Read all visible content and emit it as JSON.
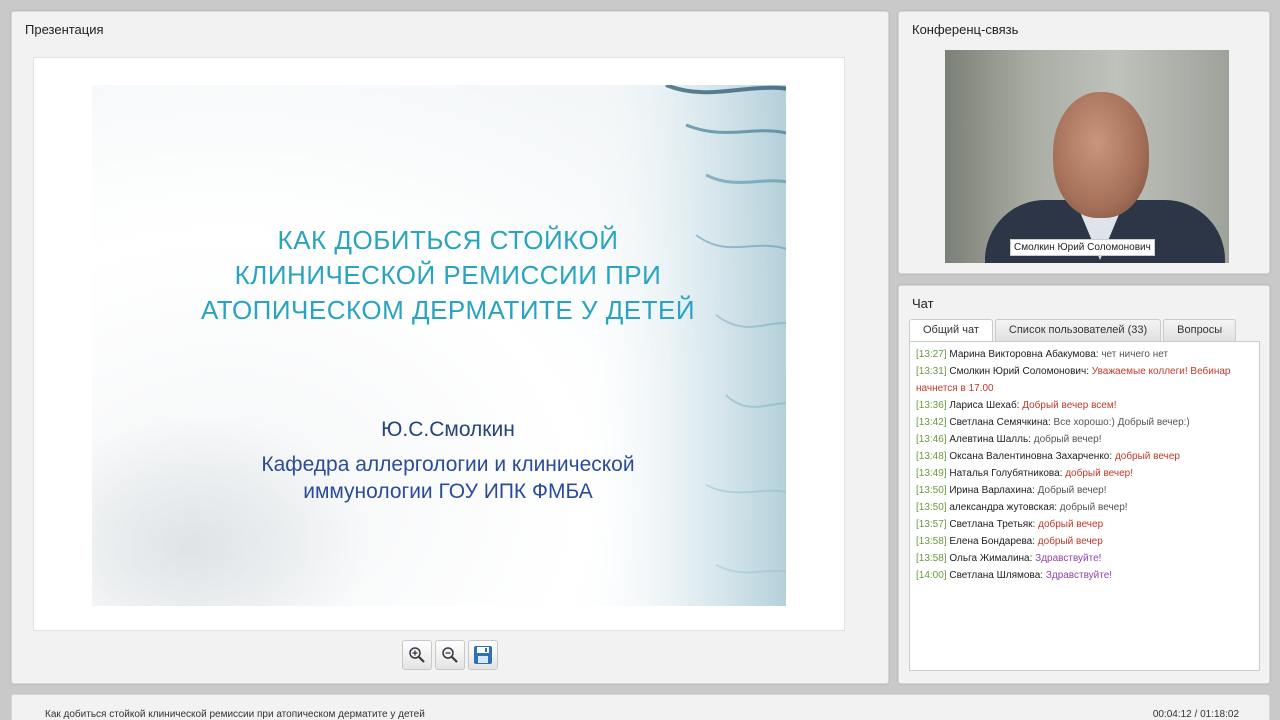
{
  "presentation": {
    "title": "Презентация",
    "slide": {
      "title_lines": [
        "КАК ДОБИТЬСЯ СТОЙКОЙ",
        "КЛИНИЧЕСКОЙ РЕМИССИИ ПРИ",
        "АТОПИЧЕСКОМ ДЕРМАТИТЕ У ДЕТЕЙ"
      ],
      "author": "Ю.С.Смолкин",
      "dept_lines": [
        "Кафедра аллергологии и клинической",
        "иммунологии ГОУ ИПК ФМБА"
      ]
    },
    "toolbar": {
      "zoom_in_icon": "zoom-in-icon",
      "zoom_out_icon": "zoom-out-icon",
      "save_icon": "floppy-disk-icon"
    }
  },
  "conference": {
    "title": "Конференц-связь",
    "speaker_name": "Смолкин Юрий Соломонович"
  },
  "chat": {
    "title": "Чат",
    "tabs": [
      "Общий чат",
      "Список пользователей (33)",
      "Вопросы"
    ],
    "active_tab": 0,
    "messages": [
      {
        "time": "[13:27]",
        "author": "Марина Викторовна Абакумова:",
        "text": "чет ничего нет",
        "color": "#555555"
      },
      {
        "time": "[13:31]",
        "author": "Смолкин Юрий Соломонович:",
        "text": "Уважаемые коллеги! Вебинар начнется в 17.00",
        "color": "#c0392b"
      },
      {
        "time": "[13:36]",
        "author": "Лариса Шехаб:",
        "text": "Добрый вечер всем!",
        "color": "#c0392b"
      },
      {
        "time": "[13:42]",
        "author": "Светлана Семячкина:",
        "text": "Все хорошо:) Добрый вечер:)",
        "color": "#555555"
      },
      {
        "time": "[13:46]",
        "author": "Алевтина Шалль:",
        "text": "добрый вечер!",
        "color": "#555555"
      },
      {
        "time": "[13:48]",
        "author": "Оксана Валентиновна Захарченко:",
        "text": "добрый вечер",
        "color": "#c0392b"
      },
      {
        "time": "[13:49]",
        "author": "Наталья Голубятникова:",
        "text": "добрый вечер!",
        "color": "#c0392b"
      },
      {
        "time": "[13:50]",
        "author": "Ирина Варлахина:",
        "text": "Добрый вечер!",
        "color": "#555555"
      },
      {
        "time": "[13:50]",
        "author": "александра жутовская:",
        "text": "добрый вечер!",
        "color": "#555555"
      },
      {
        "time": "[13:57]",
        "author": "Светлана Третьяк:",
        "text": "добрый вечер",
        "color": "#c0392b"
      },
      {
        "time": "[13:58]",
        "author": "Елена Бондарева:",
        "text": "добрый вечер",
        "color": "#c0392b"
      },
      {
        "time": "[13:58]",
        "author": "Ольга Жималина:",
        "text": "Здравствуйте!",
        "color": "#8e44ad"
      },
      {
        "time": "[14:00]",
        "author": "Светлана Шлямова:",
        "text": "Здравствуйте!",
        "color": "#8e44ad"
      }
    ]
  },
  "status": {
    "title": "Как добиться стойкой клинической ремиссии при атопическом дерматите у детей",
    "time": "00:04:12 / 01:18:02"
  }
}
